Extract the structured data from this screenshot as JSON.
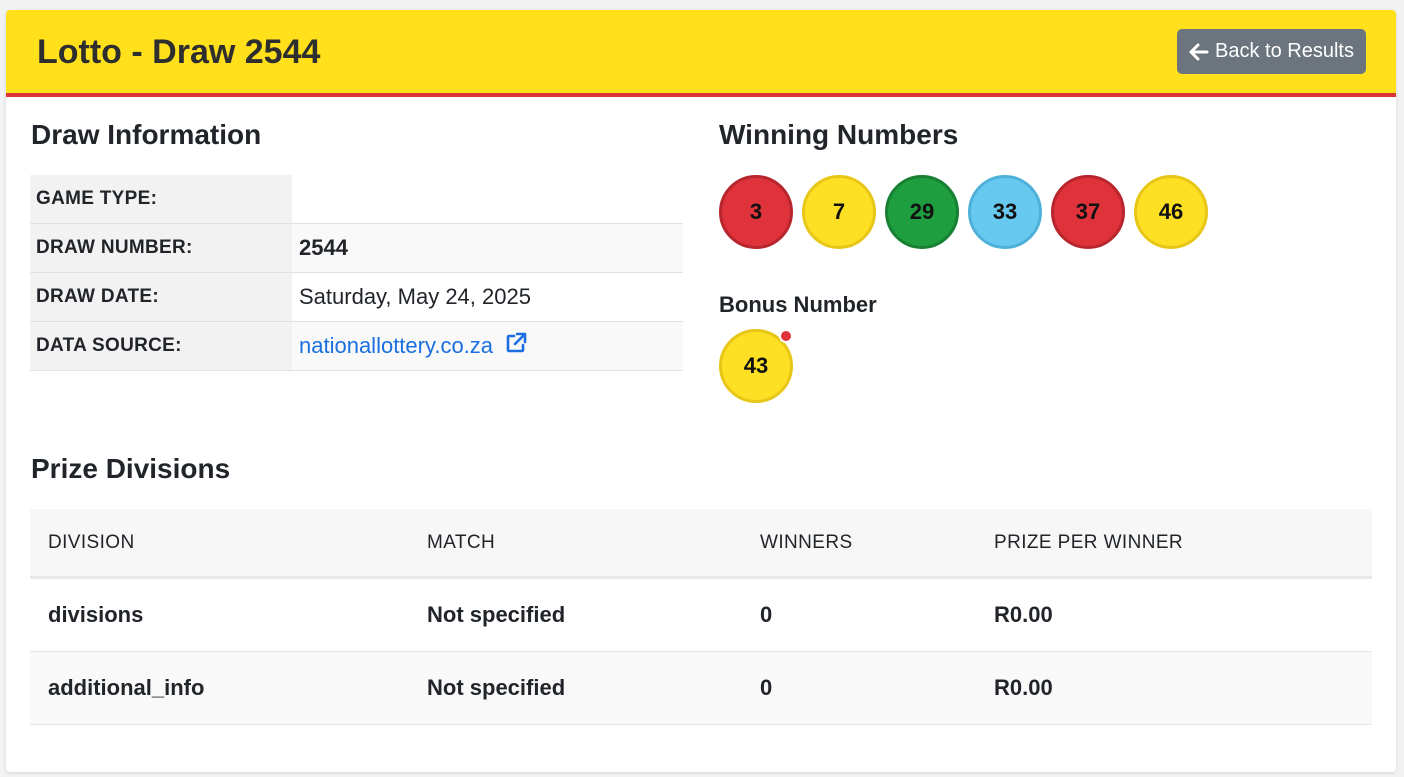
{
  "header": {
    "title": "Lotto - Draw 2544",
    "back_label": "Back to Results"
  },
  "draw_info": {
    "heading": "Draw Information",
    "rows": [
      {
        "label": "GAME TYPE:",
        "value": ""
      },
      {
        "label": "DRAW NUMBER:",
        "value": "2544"
      },
      {
        "label": "DRAW DATE:",
        "value": "Saturday, May 24, 2025"
      },
      {
        "label": "DATA SOURCE:",
        "value": "nationallottery.co.za"
      }
    ]
  },
  "winning": {
    "heading": "Winning Numbers",
    "numbers": [
      {
        "value": "3",
        "color": "#e0323a"
      },
      {
        "value": "7",
        "color": "#fde023"
      },
      {
        "value": "29",
        "color": "#1e9e3e"
      },
      {
        "value": "33",
        "color": "#67c8f0"
      },
      {
        "value": "37",
        "color": "#e0323a"
      },
      {
        "value": "46",
        "color": "#fde023"
      }
    ],
    "bonus_label": "Bonus Number",
    "bonus": {
      "value": "43",
      "color": "#fde023"
    }
  },
  "prizes": {
    "heading": "Prize Divisions",
    "columns": [
      "DIVISION",
      "MATCH",
      "WINNERS",
      "PRIZE PER WINNER"
    ],
    "rows": [
      {
        "division": "divisions",
        "match": "Not specified",
        "winners": "0",
        "prize": "R0.00"
      },
      {
        "division": "additional_info",
        "match": "Not specified",
        "winners": "0",
        "prize": "R0.00"
      }
    ]
  },
  "colors": {
    "header_bg": "#ffe01b",
    "header_border": "#dc3338",
    "button_bg": "#6c757d",
    "link": "#1a6fe0"
  },
  "icons": {
    "back": "arrow-left-icon",
    "external": "external-link-icon"
  }
}
